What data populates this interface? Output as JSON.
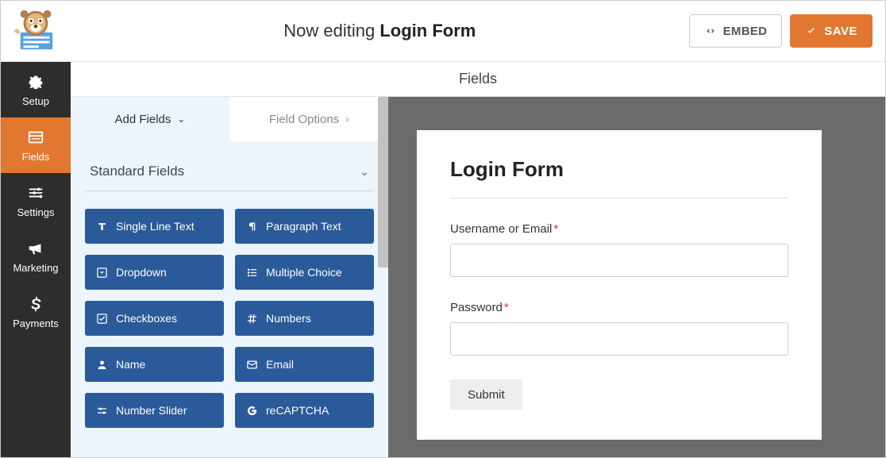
{
  "header": {
    "editing_prefix": "Now editing",
    "form_name": "Login Form",
    "embed_label": "EMBED",
    "save_label": "SAVE"
  },
  "sidenav": {
    "items": [
      {
        "key": "setup",
        "label": "Setup",
        "icon": "gear-icon"
      },
      {
        "key": "fields",
        "label": "Fields",
        "icon": "form-icon",
        "active": true
      },
      {
        "key": "settings",
        "label": "Settings",
        "icon": "sliders-icon"
      },
      {
        "key": "marketing",
        "label": "Marketing",
        "icon": "bullhorn-icon"
      },
      {
        "key": "payments",
        "label": "Payments",
        "icon": "dollar-icon"
      }
    ]
  },
  "section_title": "Fields",
  "panel": {
    "tabs": {
      "add_fields": "Add Fields",
      "field_options": "Field Options"
    },
    "group_title": "Standard Fields",
    "fields": [
      {
        "label": "Single Line Text",
        "icon": "text-icon"
      },
      {
        "label": "Paragraph Text",
        "icon": "paragraph-icon"
      },
      {
        "label": "Dropdown",
        "icon": "caret-square-icon"
      },
      {
        "label": "Multiple Choice",
        "icon": "list-icon"
      },
      {
        "label": "Checkboxes",
        "icon": "check-square-icon"
      },
      {
        "label": "Numbers",
        "icon": "hash-icon"
      },
      {
        "label": "Name",
        "icon": "user-icon"
      },
      {
        "label": "Email",
        "icon": "envelope-icon"
      },
      {
        "label": "Number Slider",
        "icon": "slider-icon"
      },
      {
        "label": "reCAPTCHA",
        "icon": "google-icon"
      }
    ]
  },
  "preview": {
    "form_title": "Login Form",
    "field1_label": "Username or Email",
    "field2_label": "Password",
    "required_marker": "*",
    "submit_label": "Submit"
  },
  "colors": {
    "accent_orange": "#e27730",
    "field_blue": "#2a5a99",
    "sidenav_bg": "#2d2d2d"
  }
}
